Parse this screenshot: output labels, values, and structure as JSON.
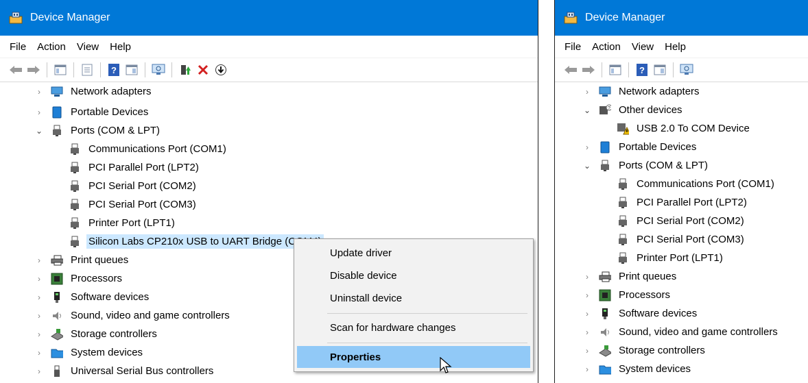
{
  "left_window": {
    "title": "Device Manager",
    "menu": [
      "File",
      "Action",
      "View",
      "Help"
    ],
    "tree": [
      {
        "label": "Network adapters",
        "icon": "network-adapter-icon",
        "expander": "collapsed"
      },
      {
        "label": "Portable Devices",
        "icon": "portable-device-icon",
        "expander": "collapsed"
      },
      {
        "label": "Ports (COM & LPT)",
        "icon": "port-icon",
        "expander": "expanded"
      },
      {
        "label": "Communications Port (COM1)",
        "icon": "port-icon",
        "expander": "none"
      },
      {
        "label": "PCI Parallel Port (LPT2)",
        "icon": "port-icon",
        "expander": "none"
      },
      {
        "label": "PCI Serial Port (COM2)",
        "icon": "port-icon",
        "expander": "none"
      },
      {
        "label": "PCI Serial Port (COM3)",
        "icon": "port-icon",
        "expander": "none"
      },
      {
        "label": "Printer Port (LPT1)",
        "icon": "port-icon",
        "expander": "none"
      },
      {
        "label": "Silicon Labs CP210x USB to UART Bridge (COM4)",
        "icon": "port-icon",
        "expander": "none",
        "selected": true
      },
      {
        "label": "Print queues",
        "icon": "printer-icon",
        "expander": "collapsed"
      },
      {
        "label": "Processors",
        "icon": "processor-icon",
        "expander": "collapsed"
      },
      {
        "label": "Software devices",
        "icon": "software-device-icon",
        "expander": "collapsed"
      },
      {
        "label": "Sound, video and game controllers",
        "icon": "sound-icon",
        "expander": "collapsed"
      },
      {
        "label": "Storage controllers",
        "icon": "storage-icon",
        "expander": "collapsed"
      },
      {
        "label": "System devices",
        "icon": "system-device-icon",
        "expander": "collapsed"
      },
      {
        "label": "Universal Serial Bus controllers",
        "icon": "usb-icon",
        "expander": "collapsed"
      }
    ],
    "context_menu": [
      {
        "label": "Update driver",
        "accel": "p"
      },
      {
        "label": "Disable device",
        "accel": "D"
      },
      {
        "label": "Uninstall device",
        "accel": "U"
      },
      {
        "label": "Scan for hardware changes",
        "accel": "a"
      },
      {
        "label": "Properties",
        "accel": "P",
        "highlighted": true
      }
    ]
  },
  "right_window": {
    "title": "Device Manager",
    "menu": [
      "File",
      "Action",
      "View",
      "Help"
    ],
    "tree": [
      {
        "label": "Network adapters",
        "icon": "network-adapter-icon",
        "expander": "collapsed"
      },
      {
        "label": "Other devices",
        "icon": "unknown-device-icon",
        "expander": "expanded"
      },
      {
        "label": "USB 2.0 To COM Device",
        "icon": "warning-device-icon",
        "expander": "none"
      },
      {
        "label": "Portable Devices",
        "icon": "portable-device-icon",
        "expander": "collapsed"
      },
      {
        "label": "Ports (COM & LPT)",
        "icon": "port-icon",
        "expander": "expanded"
      },
      {
        "label": "Communications Port (COM1)",
        "icon": "port-icon",
        "expander": "none"
      },
      {
        "label": "PCI Parallel Port (LPT2)",
        "icon": "port-icon",
        "expander": "none"
      },
      {
        "label": "PCI Serial Port (COM2)",
        "icon": "port-icon",
        "expander": "none"
      },
      {
        "label": "PCI Serial Port (COM3)",
        "icon": "port-icon",
        "expander": "none"
      },
      {
        "label": "Printer Port (LPT1)",
        "icon": "port-icon",
        "expander": "none"
      },
      {
        "label": "Print queues",
        "icon": "printer-icon",
        "expander": "collapsed"
      },
      {
        "label": "Processors",
        "icon": "processor-icon",
        "expander": "collapsed"
      },
      {
        "label": "Software devices",
        "icon": "software-device-icon",
        "expander": "collapsed"
      },
      {
        "label": "Sound, video and game controllers",
        "icon": "sound-icon",
        "expander": "collapsed"
      },
      {
        "label": "Storage controllers",
        "icon": "storage-icon",
        "expander": "collapsed"
      },
      {
        "label": "System devices",
        "icon": "system-device-icon",
        "expander": "collapsed"
      }
    ]
  },
  "colors": {
    "titlebar": "#0078d7",
    "selection": "#cce8ff",
    "menu_highlight": "#91c9f7"
  }
}
